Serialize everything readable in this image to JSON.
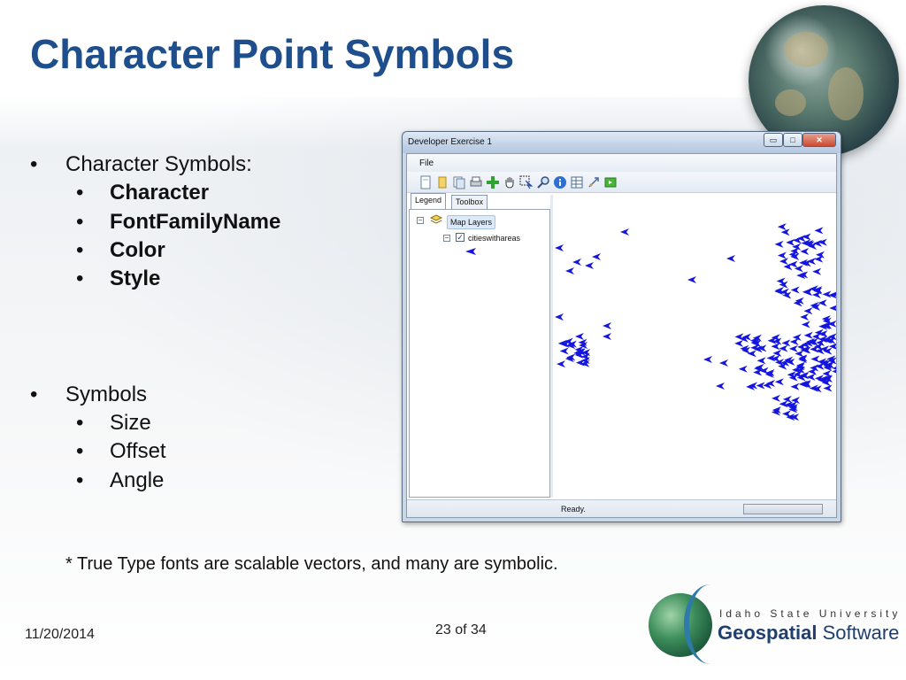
{
  "slide": {
    "title": "Character Point Symbols",
    "bullets_group1": {
      "heading": "Character Symbols:",
      "items": [
        "Character",
        "FontFamilyName",
        "Color",
        "Style"
      ]
    },
    "bullets_group2": {
      "heading": "Symbols",
      "items": [
        "Size",
        "Offset",
        "Angle"
      ]
    },
    "footnote": "* True Type fonts are scalable vectors, and many are symbolic.",
    "date": "11/20/2014",
    "page": "23 of 34",
    "logo": {
      "university": "Idaho State University",
      "lab_bold": "Geospatial",
      "lab_rest": " Software Lab"
    },
    "bullet_glyph": "•"
  },
  "app": {
    "window_title": "Developer Exercise 1",
    "menu": {
      "file": "File"
    },
    "tabs": [
      "Legend",
      "Toolbox"
    ],
    "legend": {
      "root_label": "Map Layers",
      "layer_label": "citieswithareas",
      "expander_minus": "⊟"
    },
    "status": "Ready.",
    "window_buttons": {
      "min": "▭",
      "max": "□",
      "close": "✕"
    },
    "toolbar_icons": [
      "new-document-icon",
      "open-folder-icon",
      "save-icon",
      "print-icon",
      "add-layer-icon",
      "pan-hand-icon",
      "select-icon",
      "zoom-icon",
      "info-icon",
      "table-icon",
      "measure-icon",
      "extent-icon"
    ],
    "colors": {
      "symbol": "#1515e0",
      "title": "#1f4e8c"
    }
  }
}
